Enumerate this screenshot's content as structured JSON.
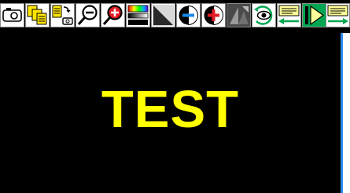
{
  "toolbar": {
    "tools": [
      {
        "name": "camera-icon"
      },
      {
        "name": "multiple-pages-icon"
      },
      {
        "name": "page-to-camera-icon"
      },
      {
        "name": "zoom-out-icon"
      },
      {
        "name": "zoom-in-icon"
      },
      {
        "name": "color-scale-icon"
      },
      {
        "name": "triangle-select-icon"
      },
      {
        "name": "contrast-decrease-icon"
      },
      {
        "name": "contrast-increase-icon"
      },
      {
        "name": "grey-triangles-icon"
      },
      {
        "name": "eye-view-icon"
      },
      {
        "name": "previous-step-icon"
      },
      {
        "name": "play-icon"
      },
      {
        "name": "next-step-icon"
      }
    ]
  },
  "canvas": {
    "text": "TEST",
    "text_color": "#ffff00",
    "background": "#000000"
  },
  "colors": {
    "accent_green": "#00a651",
    "accent_yellow": "#ffff00",
    "accent_red": "#e31b23",
    "scroll_blue": "#2b8ef0"
  }
}
